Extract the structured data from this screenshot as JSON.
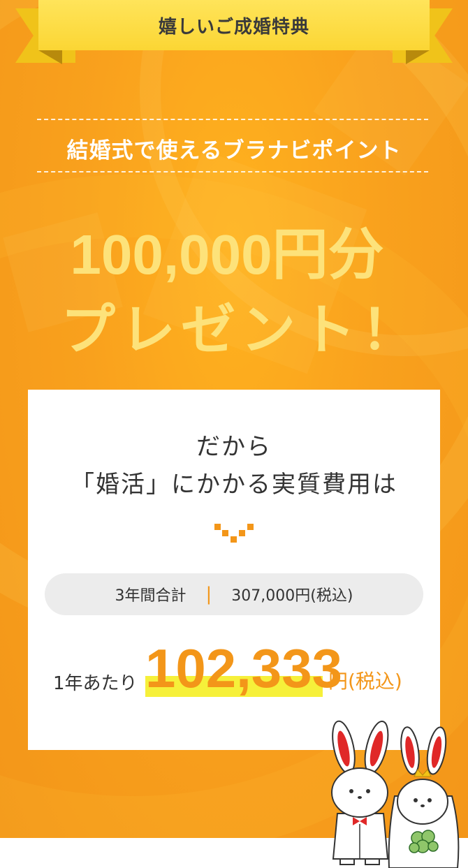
{
  "ribbon": {
    "label": "嬉しいご成婚特典"
  },
  "points": {
    "title": "結婚式で使えるブラナビポイント",
    "amount": "100,000円分",
    "present": "プレゼント！"
  },
  "card": {
    "line1": "だから",
    "line2": "「婚活」にかかる実質費用は",
    "summary_label": "3年間合計",
    "summary_value": "307,000円(税込)",
    "per_year_label": "1年あたり",
    "per_year_value": "102,333",
    "per_year_unit": "円(税込)"
  },
  "colors": {
    "orange": "#f39619",
    "yellow": "#fbd634",
    "highlight": "#f6f03a"
  },
  "illustration": {
    "icon": "rabbit-couple-illustration"
  }
}
